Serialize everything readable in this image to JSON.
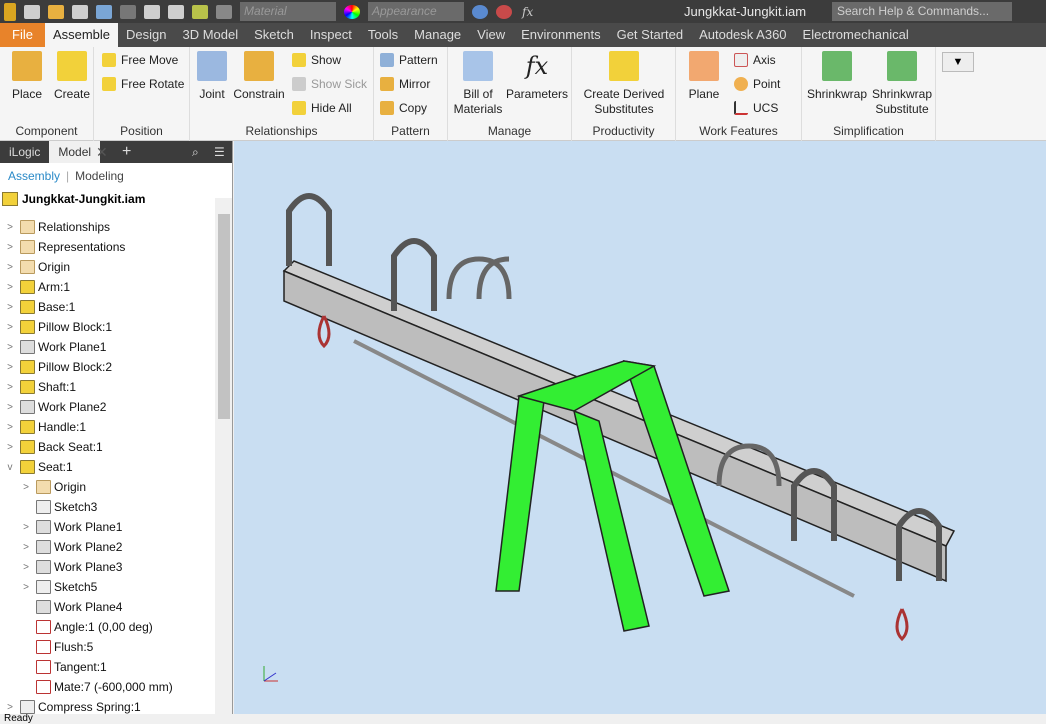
{
  "app": {
    "title": "Jungkkat-Jungkit.iam",
    "search_placeholder": "Search Help & Commands...",
    "material": "Material",
    "appearance": "Appearance"
  },
  "tabs": [
    "File",
    "Assemble",
    "Design",
    "3D Model",
    "Sketch",
    "Inspect",
    "Tools",
    "Manage",
    "View",
    "Environments",
    "Get Started",
    "Autodesk A360",
    "Electromechanical"
  ],
  "ribbon": {
    "component": {
      "label": "Component",
      "place": "Place",
      "create": "Create"
    },
    "position": {
      "label": "Position",
      "free_move": "Free Move",
      "free_rotate": "Free Rotate"
    },
    "relationships": {
      "label": "Relationships",
      "joint": "Joint",
      "constrain": "Constrain",
      "show": "Show",
      "show_sick": "Show Sick",
      "hide_all": "Hide All"
    },
    "pattern": {
      "label": "Pattern",
      "pattern": "Pattern",
      "mirror": "Mirror",
      "copy": "Copy"
    },
    "manage": {
      "label": "Manage",
      "bom": "Bill of Materials",
      "parameters": "Parameters"
    },
    "productivity": {
      "label": "Productivity",
      "derived": "Create Derived Substitutes"
    },
    "work_features": {
      "label": "Work Features",
      "plane": "Plane",
      "axis": "Axis",
      "point": "Point",
      "ucs": "UCS"
    },
    "simplification": {
      "label": "Simplification",
      "shrinkwrap": "Shrinkwrap",
      "shrinkwrap_sub": "Shrinkwrap Substitute"
    }
  },
  "browser": {
    "tabs": [
      "iLogic",
      "Model"
    ],
    "modes": [
      "Assembly",
      "Modeling"
    ],
    "root": "Jungkkat-Jungkit.iam",
    "items": [
      {
        "label": "Relationships",
        "icon": "folder",
        "level": 0,
        "exp": ">"
      },
      {
        "label": "Representations",
        "icon": "folder",
        "level": 0,
        "exp": ">"
      },
      {
        "label": "Origin",
        "icon": "folder",
        "level": 0,
        "exp": ">"
      },
      {
        "label": "Arm:1",
        "icon": "part",
        "level": 0,
        "exp": ">"
      },
      {
        "label": "Base:1",
        "icon": "part",
        "level": 0,
        "exp": ">"
      },
      {
        "label": "Pillow Block:1",
        "icon": "part",
        "level": 0,
        "exp": ">"
      },
      {
        "label": "Work Plane1",
        "icon": "wp",
        "level": 0,
        "exp": ">"
      },
      {
        "label": "Pillow Block:2",
        "icon": "part",
        "level": 0,
        "exp": ">"
      },
      {
        "label": "Shaft:1",
        "icon": "part",
        "level": 0,
        "exp": ">"
      },
      {
        "label": "Work Plane2",
        "icon": "wp",
        "level": 0,
        "exp": ">"
      },
      {
        "label": "Handle:1",
        "icon": "part",
        "level": 0,
        "exp": ">"
      },
      {
        "label": "Back Seat:1",
        "icon": "part",
        "level": 0,
        "exp": ">"
      },
      {
        "label": "Seat:1",
        "icon": "part",
        "level": 0,
        "exp": "v"
      },
      {
        "label": "Origin",
        "icon": "folder",
        "level": 1,
        "exp": ">"
      },
      {
        "label": "Sketch3",
        "icon": "sk",
        "level": 1,
        "exp": ""
      },
      {
        "label": "Work Plane1",
        "icon": "wp",
        "level": 1,
        "exp": ">"
      },
      {
        "label": "Work Plane2",
        "icon": "wp",
        "level": 1,
        "exp": ">"
      },
      {
        "label": "Work Plane3",
        "icon": "wp",
        "level": 1,
        "exp": ">"
      },
      {
        "label": "Sketch5",
        "icon": "sk",
        "level": 1,
        "exp": ">"
      },
      {
        "label": "Work Plane4",
        "icon": "wp",
        "level": 1,
        "exp": ""
      },
      {
        "label": "Angle:1 (0,00 deg)",
        "icon": "con",
        "level": 1,
        "exp": ""
      },
      {
        "label": "Flush:5",
        "icon": "con",
        "level": 1,
        "exp": ""
      },
      {
        "label": "Tangent:1",
        "icon": "con",
        "level": 1,
        "exp": ""
      },
      {
        "label": "Mate:7 (-600,000 mm)",
        "icon": "con",
        "level": 1,
        "exp": ""
      },
      {
        "label": "Compress Spring:1",
        "icon": "sk",
        "level": 0,
        "exp": ">"
      }
    ]
  },
  "status": "Ready",
  "colors": {
    "accent": "#e8832a",
    "viewport": "#c9def2",
    "legs": "#33ee22"
  }
}
